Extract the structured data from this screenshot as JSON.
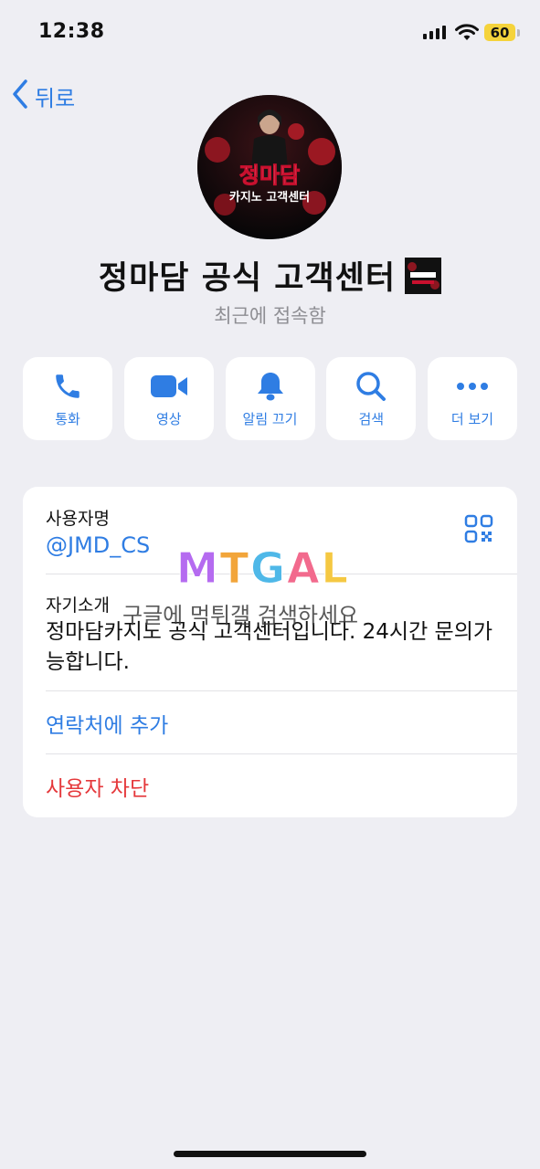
{
  "status_bar": {
    "time": "12:38",
    "battery": "60"
  },
  "nav": {
    "back_label": "뒤로"
  },
  "profile": {
    "name": "정마담 공식 고객센터",
    "last_seen": "최근에 접속함",
    "avatar_text_line1": "정마담",
    "avatar_text_line2": "카지노 고객센터"
  },
  "actions": [
    {
      "label": "통화",
      "icon": "phone-icon"
    },
    {
      "label": "영상",
      "icon": "video-icon"
    },
    {
      "label": "알림 끄기",
      "icon": "bell-icon"
    },
    {
      "label": "검색",
      "icon": "search-icon"
    },
    {
      "label": "더 보기",
      "icon": "more-icon"
    }
  ],
  "info": {
    "username_label": "사용자명",
    "username": "@JMD_CS",
    "bio_label": "자기소개",
    "bio": "정마담카지노 공식 고객센터입니다. 24시간 문의가능합니다.",
    "add_contact": "연락처에 추가",
    "block_user": "사용자 차단"
  },
  "watermark": {
    "logo": "MTGAL",
    "text": "구글에 먹튀갤 검색하세요"
  },
  "colors": {
    "accent": "#2f7de3",
    "danger": "#e5383b",
    "background": "#eeeef3",
    "battery": "#f5d33b"
  }
}
